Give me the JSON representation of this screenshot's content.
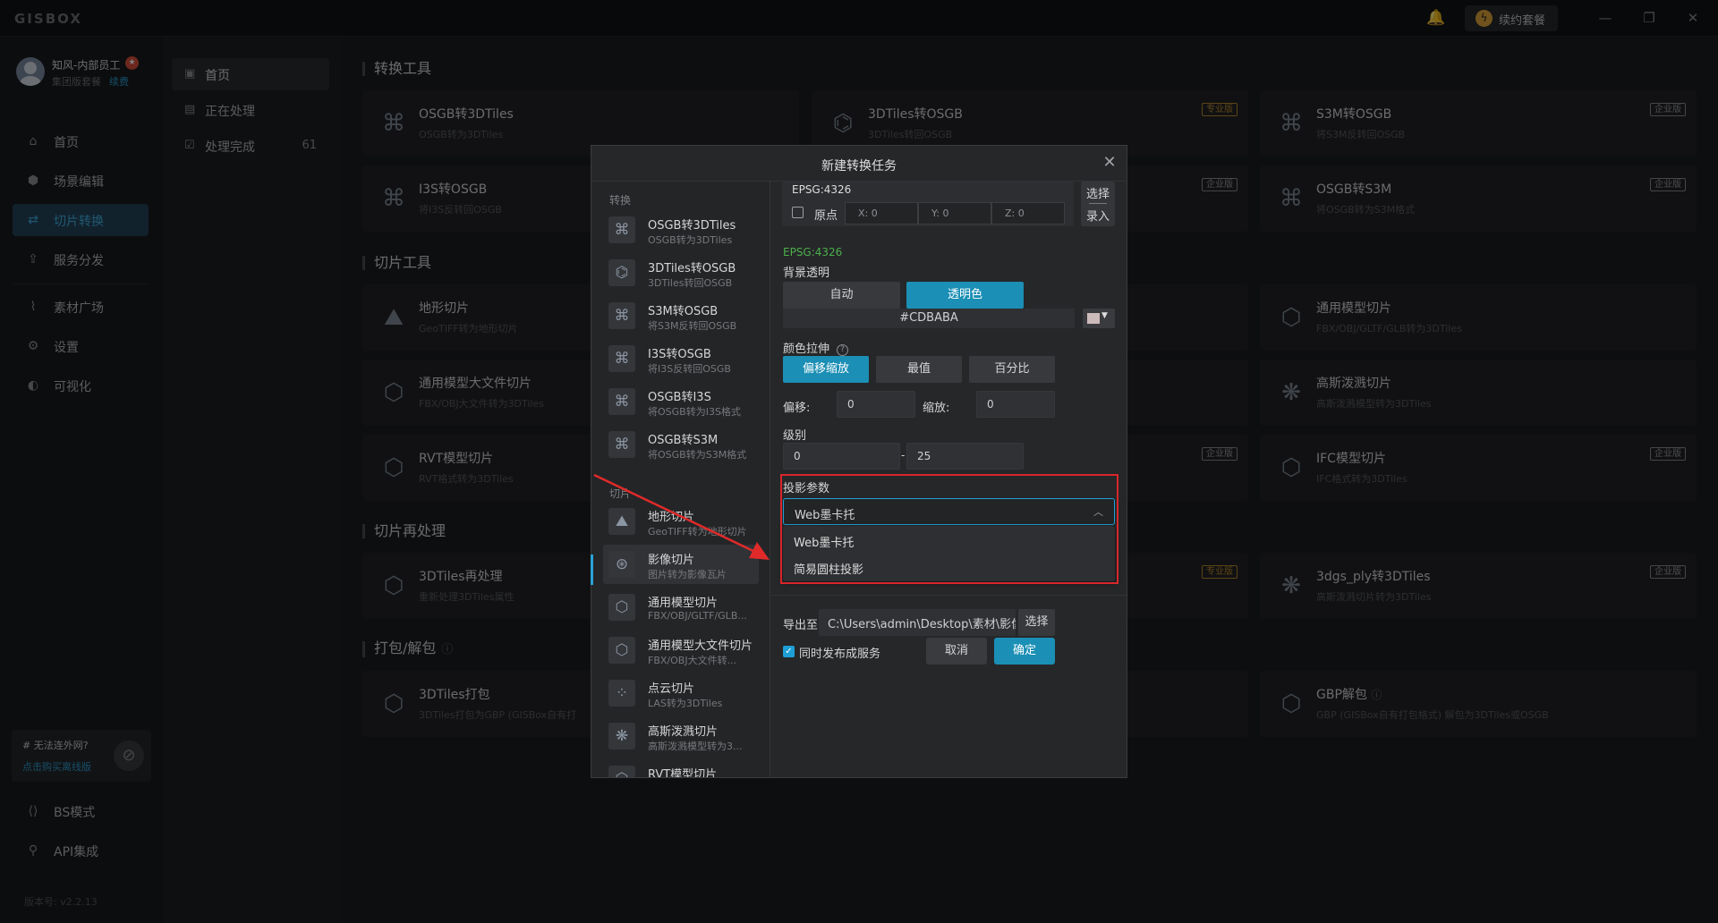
{
  "app": {
    "logo": "GISBOX",
    "renew_label": "续约套餐",
    "win_min": "—",
    "win_max": "❐",
    "win_close": "✕"
  },
  "user": {
    "name": "知风-内部员工",
    "plan": "集团版套餐",
    "renew": "续费"
  },
  "nav": [
    {
      "label": "首页",
      "icon": "home-icon",
      "glyph": "⌂"
    },
    {
      "label": "场景编辑",
      "icon": "scene-edit-icon",
      "glyph": "⬢"
    },
    {
      "label": "切片转换",
      "icon": "convert-icon",
      "glyph": "⇄"
    },
    {
      "label": "服务分发",
      "icon": "publish-icon",
      "glyph": "⇪"
    },
    {
      "label": "素材广场",
      "icon": "chart-icon",
      "glyph": "⌇"
    },
    {
      "label": "设置",
      "icon": "gear-icon",
      "glyph": "⚙"
    },
    {
      "label": "可视化",
      "icon": "visual-icon",
      "glyph": "◐"
    }
  ],
  "nav_bottom": [
    {
      "label": "BS模式",
      "glyph": "⟨⟩"
    },
    {
      "label": "API集成",
      "glyph": "⚲"
    }
  ],
  "net": {
    "title": "# 无法连外网?",
    "link": "点击购买离线版"
  },
  "version": "版本号: v2.2.13",
  "subnav": [
    {
      "label": "首页",
      "count": ""
    },
    {
      "label": "正在处理",
      "count": ""
    },
    {
      "label": "处理完成",
      "count": "61"
    }
  ],
  "sections": {
    "convert": "转换工具",
    "slice": "切片工具",
    "reprocess": "切片再处理",
    "pack": "打包/解包",
    "pack_q": "?"
  },
  "cards": [
    {
      "title": "OSGB转3DTiles",
      "sub": "OSGB转为3DTiles",
      "badge": ""
    },
    {
      "title": "3DTiles转OSGB",
      "sub": "3DTiles转回OSGB",
      "badge": "专业版"
    },
    {
      "title": "S3M转OSGB",
      "sub": "将S3M反转回OSGB",
      "badge": "企业版"
    },
    {
      "title": "I3S转OSGB",
      "sub": "将I3S反转回OSGB",
      "badge": "企业版"
    },
    {
      "title": "OSGB转S3M",
      "sub": "将OSGB转为S3M格式",
      "badge": "企业版"
    },
    {
      "title": "地形切片",
      "sub": "GeoTIFF转为地形切片",
      "badge": ""
    },
    {
      "title": "通用模型切片",
      "sub": "FBX/OBJ/GLTF/GLB转为3DTiles",
      "badge": ""
    },
    {
      "title": "通用模型大文件切片",
      "sub": "FBX/OBJ大文件转为3DTiles",
      "badge": ""
    },
    {
      "title": "高斯泼溅切片",
      "sub": "高斯泼溅模型转为3DTiles",
      "badge": ""
    },
    {
      "title": "RVT模型切片",
      "sub": "RVT格式转为3DTiles",
      "badge": "企业版"
    },
    {
      "title": "IFC模型切片",
      "sub": "IFC格式转为3DTiles",
      "badge": "企业版"
    },
    {
      "title": "3DTiles再处理",
      "sub": "重新处理3DTiles属性",
      "badge": "专业版"
    },
    {
      "title": "3dgs_ply转3DTiles",
      "sub": "高斯泼溅切片转为3DTiles",
      "badge": "企业版"
    },
    {
      "title": "3DTiles打包",
      "sub": "3DTiles打包为GBP (GISBox自有打",
      "badge": ""
    },
    {
      "title": "GBP解包",
      "sub": "GBP (GISBox自有打包格式) 解包为3DTiles或OSGB",
      "badge": ""
    }
  ],
  "dialog": {
    "title": "新建转换任务",
    "group_convert": "转换",
    "group_slice": "切片",
    "list": [
      {
        "t1": "OSGB转3DTiles",
        "t2": "OSGB转为3DTiles"
      },
      {
        "t1": "3DTiles转OSGB",
        "t2": "3DTiles转回OSGB"
      },
      {
        "t1": "S3M转OSGB",
        "t2": "将S3M反转回OSGB"
      },
      {
        "t1": "I3S转OSGB",
        "t2": "将I3S反转回OSGB"
      },
      {
        "t1": "OSGB转I3S",
        "t2": "将OSGB转为I3S格式"
      },
      {
        "t1": "OSGB转S3M",
        "t2": "将OSGB转为S3M格式"
      },
      {
        "t1": "地形切片",
        "t2": "GeoTIFF转为地形切片"
      },
      {
        "t1": "影像切片",
        "t2": "图片转为影像瓦片"
      },
      {
        "t1": "通用模型切片",
        "t2": "FBX/OBJ/GLTF/GLB..."
      },
      {
        "t1": "通用模型大文件切片",
        "t2": "FBX/OBJ大文件转..."
      },
      {
        "t1": "点云切片",
        "t2": "LAS转为3DTiles"
      },
      {
        "t1": "高斯泼溅切片",
        "t2": "高斯泼溅模型转为3..."
      },
      {
        "t1": "RVT模型切片",
        "t2": ""
      }
    ],
    "epsg": "EPSG:4326",
    "origin_label": "原点",
    "x": "X: 0",
    "y": "Y: 0",
    "z": "Z: 0",
    "select_a": "选择",
    "select_b": "录入",
    "epsg_green": "EPSG:4326",
    "bg_label": "背景透明",
    "bg_auto": "自动",
    "bg_transparent": "透明色",
    "color_value": "#CDBABA",
    "stretch_label": "颜色拉伸",
    "stretch_opts": [
      "偏移缩放",
      "最值",
      "百分比"
    ],
    "offset_label": "偏移:",
    "offset_value": "0",
    "scale_label": "缩放:",
    "scale_value": "0",
    "level_label": "级别",
    "level_min": "0",
    "level_sep": "-",
    "level_max": "25",
    "proj_label": "投影参数",
    "proj_selected": "Web墨卡托",
    "proj_options": [
      "Web墨卡托",
      "简易圆柱投影"
    ],
    "export_label": "导出至",
    "export_path": "C:\\Users\\admin\\Desktop\\素材\\影像\\out...",
    "export_select": "选择",
    "publish_label": "同时发布成服务",
    "cancel": "取消",
    "confirm": "确定"
  },
  "colors": {
    "accent": "#1b8fb5",
    "highlight_box": "#d8262a",
    "swatch": "#cdbaba"
  }
}
